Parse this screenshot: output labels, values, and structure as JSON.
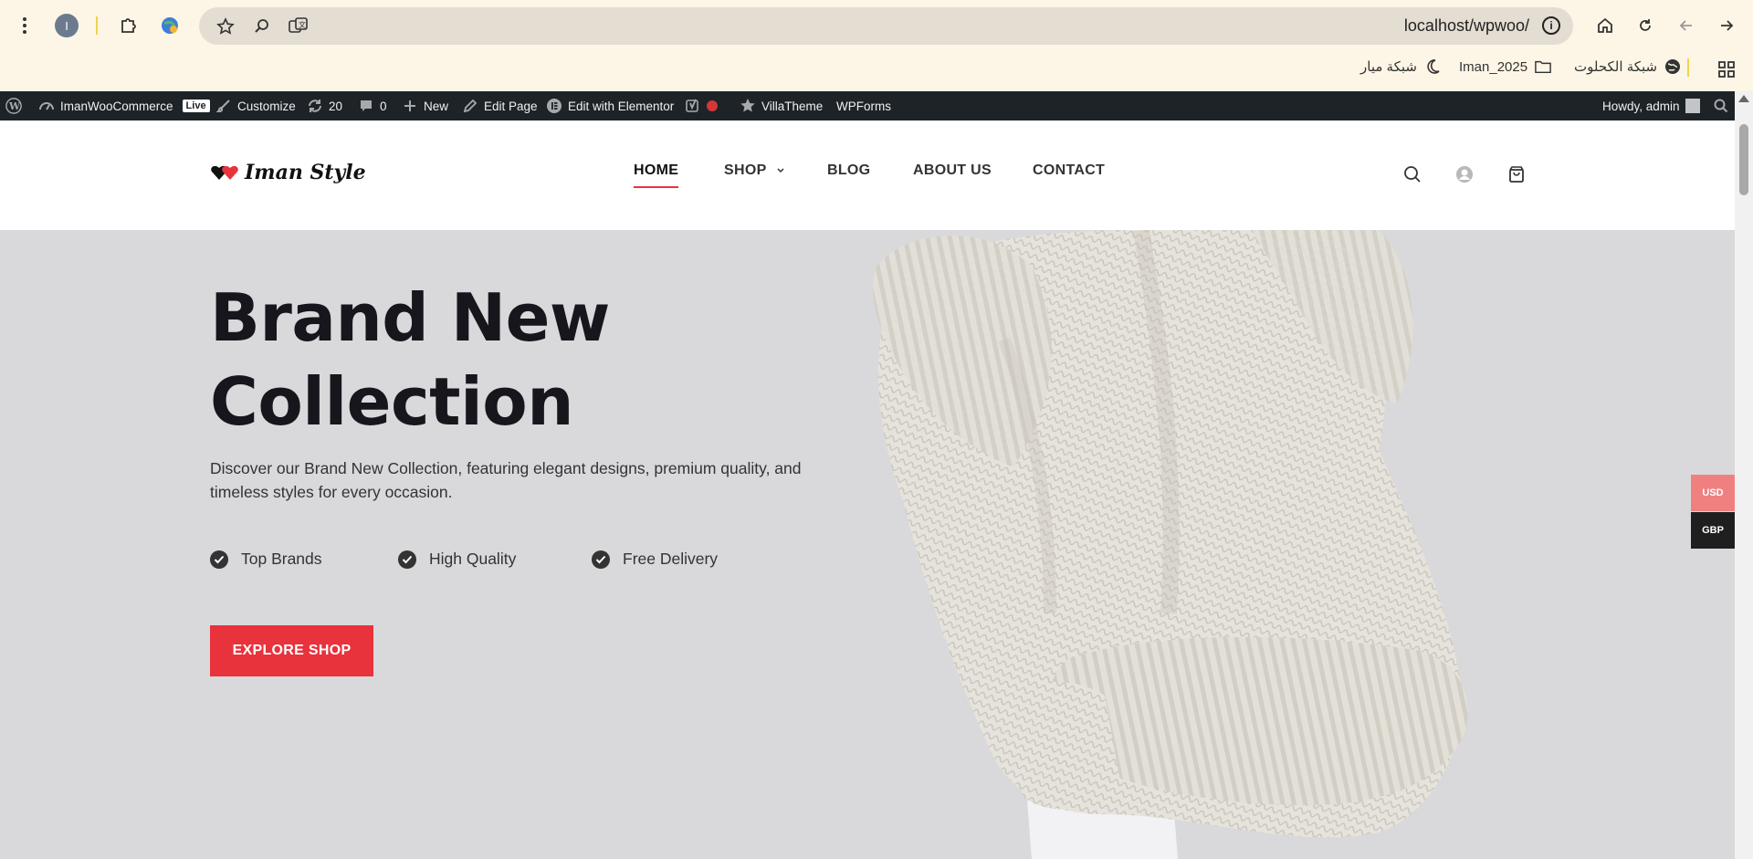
{
  "browser": {
    "profile_initial": "I",
    "url": "localhost/wpwoo/",
    "bookmarks": [
      {
        "label": "شبكة الكحلوت",
        "icon": "globe-icon"
      },
      {
        "label": "Iman_2025",
        "icon": "folder-icon"
      },
      {
        "label": "شبكة ميار",
        "icon": "crescent-icon"
      }
    ]
  },
  "adminbar": {
    "site_name": "ImanWooCommerce",
    "live_badge": "Live",
    "customize": "Customize",
    "updates_count": "20",
    "comments_count": "0",
    "new": "New",
    "edit_page": "Edit Page",
    "elementor": "Edit with Elementor",
    "villatheme": "VillaTheme",
    "wpforms": "WPForms",
    "howdy": "Howdy, admin"
  },
  "site": {
    "logo_text": "Iman Style",
    "nav": [
      {
        "label": "HOME",
        "active": true
      },
      {
        "label": "SHOP",
        "has_dropdown": true
      },
      {
        "label": "BLOG"
      },
      {
        "label": "ABOUT US"
      },
      {
        "label": "CONTACT"
      }
    ]
  },
  "hero": {
    "title_line1": "Brand New",
    "title_line2": "Collection",
    "description": "Discover our Brand New Collection, featuring elegant designs, premium quality, and timeless styles for every occasion.",
    "features": [
      "Top Brands",
      "High Quality",
      "Free Delivery"
    ],
    "cta": "EXPLORE SHOP"
  },
  "currency": {
    "options": [
      "USD",
      "GBP"
    ],
    "selected": "USD"
  },
  "colors": {
    "accent": "#e8323c",
    "adminbar": "#1d2327",
    "hero_bg": "#d9d9db",
    "chrome_bg": "#fdf6e6"
  }
}
